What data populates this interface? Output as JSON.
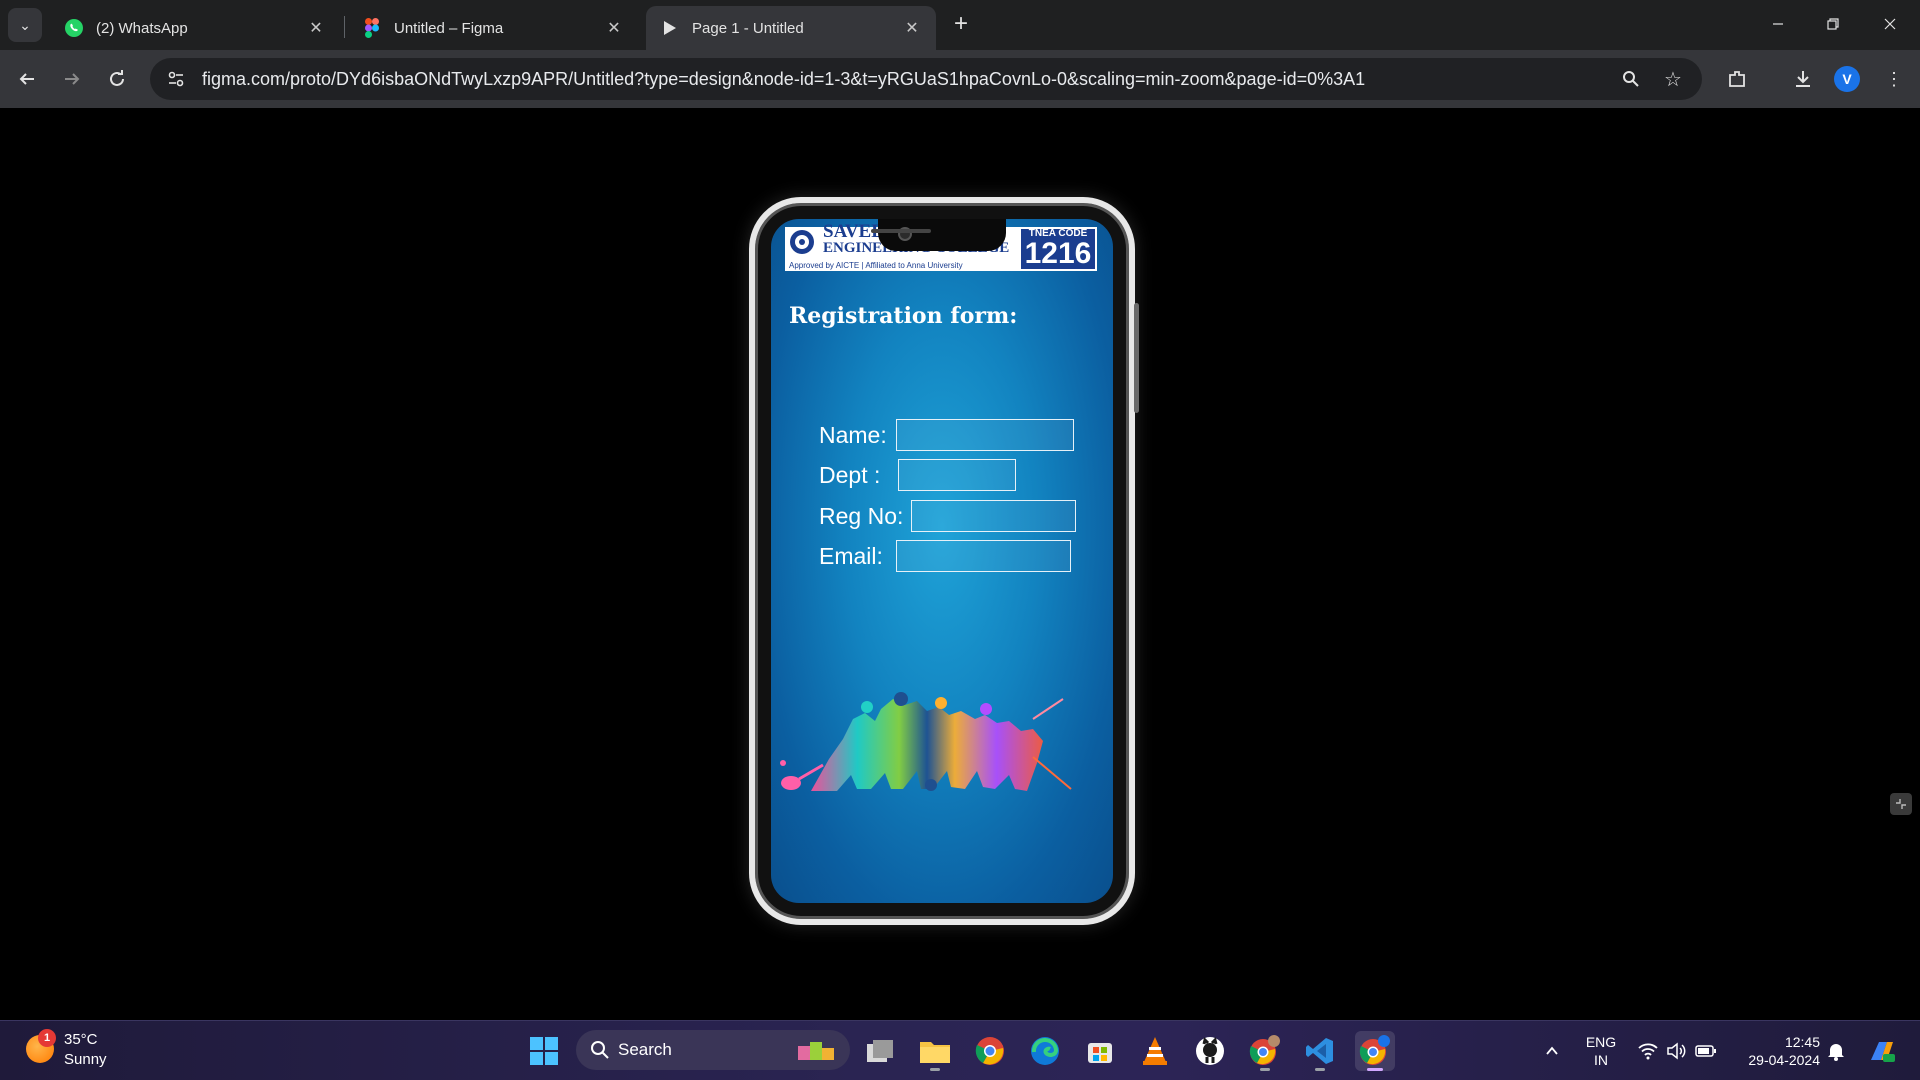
{
  "browser": {
    "tabs": [
      {
        "title": "(2) WhatsApp",
        "icon": "whatsapp-icon",
        "active": false
      },
      {
        "title": "Untitled – Figma",
        "icon": "figma-icon",
        "active": false
      },
      {
        "title": "Page 1 - Untitled",
        "icon": "play-icon",
        "active": true
      }
    ],
    "url": "figma.com/proto/DYd6isbaONdTwyLxzp9APR/Untitled?type=design&node-id=1-3&t=yRGUaS1hpaCovnLo-0&scaling=min-zoom&page-id=0%3A1",
    "profile_initial": "V"
  },
  "prototype": {
    "banner": {
      "college_name_line1": "SAVEETHA",
      "college_name_line2": "ENGINEERING COLLEGE",
      "affiliation": "Approved by AICTE | Affiliated to Anna University",
      "tnea_label": "TNEA CODE",
      "tnea_code": "1216"
    },
    "form": {
      "title": "Registration form:",
      "fields": [
        {
          "label": "Name:",
          "value": ""
        },
        {
          "label": "Dept :",
          "value": ""
        },
        {
          "label": "Reg No:",
          "value": ""
        },
        {
          "label": "Email:",
          "value": ""
        }
      ]
    },
    "colors": {
      "screen_bg": "#1283c0",
      "banner_blue": "#1b3d8f"
    }
  },
  "taskbar": {
    "weather": {
      "temp": "35°C",
      "condition": "Sunny",
      "badge": "1"
    },
    "search_label": "Search",
    "apps": [
      "windows-start-icon",
      "task-view-icon",
      "file-explorer-icon",
      "chrome-icon",
      "edge-icon",
      "microsoft-store-icon",
      "vlc-icon",
      "github-icon",
      "chrome-profile-icon",
      "vscode-icon",
      "chrome-active-icon"
    ],
    "language": {
      "line1": "ENG",
      "line2": "IN"
    },
    "time": "12:45",
    "date": "29-04-2024"
  }
}
